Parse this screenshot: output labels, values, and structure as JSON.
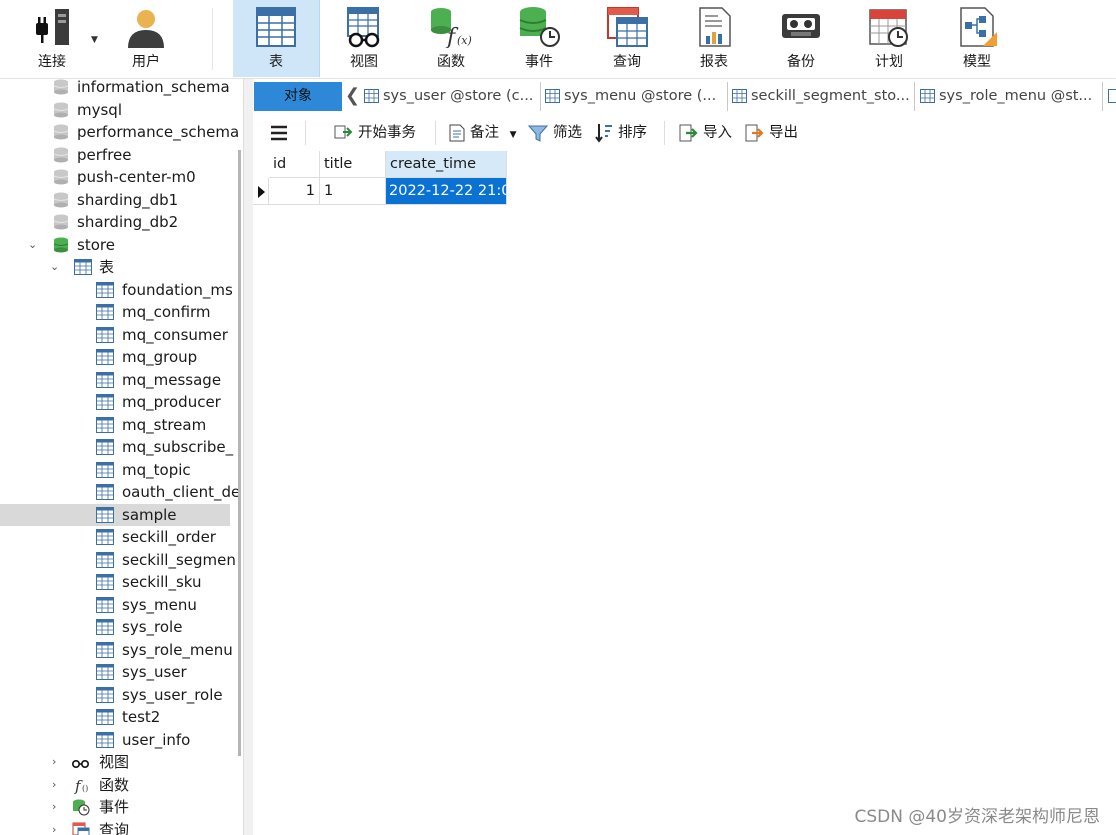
{
  "toolbar": {
    "connect": "连接",
    "user": "用户",
    "table": "表",
    "view": "视图",
    "function": "函数",
    "event": "事件",
    "query": "查询",
    "report": "报表",
    "backup": "备份",
    "schedule": "计划",
    "model": "模型"
  },
  "tree": {
    "databases": [
      "information_schema",
      "mysql",
      "performance_schema",
      "perfree",
      "push-center-m0",
      "sharding_db1",
      "sharding_db2"
    ],
    "store": "store",
    "tables_label": "表",
    "tables": [
      "foundation_ms",
      "mq_confirm",
      "mq_consumer",
      "mq_group",
      "mq_message",
      "mq_producer",
      "mq_stream",
      "mq_subscribe_",
      "mq_topic",
      "oauth_client_de",
      "sample",
      "seckill_order",
      "seckill_segmen",
      "seckill_sku",
      "sys_menu",
      "sys_role",
      "sys_role_menu",
      "sys_user",
      "sys_user_role",
      "test2",
      "user_info"
    ],
    "selected_table": "sample",
    "views_label": "视图",
    "functions_label": "函数",
    "events_label": "事件",
    "queries_label": "查询"
  },
  "tabs": {
    "objects": "对象",
    "open": [
      "sys_user @store (c...",
      "sys_menu @store (...",
      "seckill_segment_sto...",
      "sys_role_menu @st..."
    ]
  },
  "subtoolbar": {
    "begin_transaction": "开始事务",
    "memo": "备注",
    "filter": "筛选",
    "sort": "排序",
    "import": "导入",
    "export": "导出"
  },
  "grid": {
    "columns": [
      "id",
      "title",
      "create_time"
    ],
    "rows": [
      [
        "1",
        "1",
        "2022-12-22 21:0"
      ]
    ]
  },
  "watermark": "CSDN @40岁资深老架构师尼恩",
  "colors": {
    "accent": "#2e88d8",
    "selected_cell": "#0a72d3",
    "active_toolbar": "#cfe6f8"
  }
}
